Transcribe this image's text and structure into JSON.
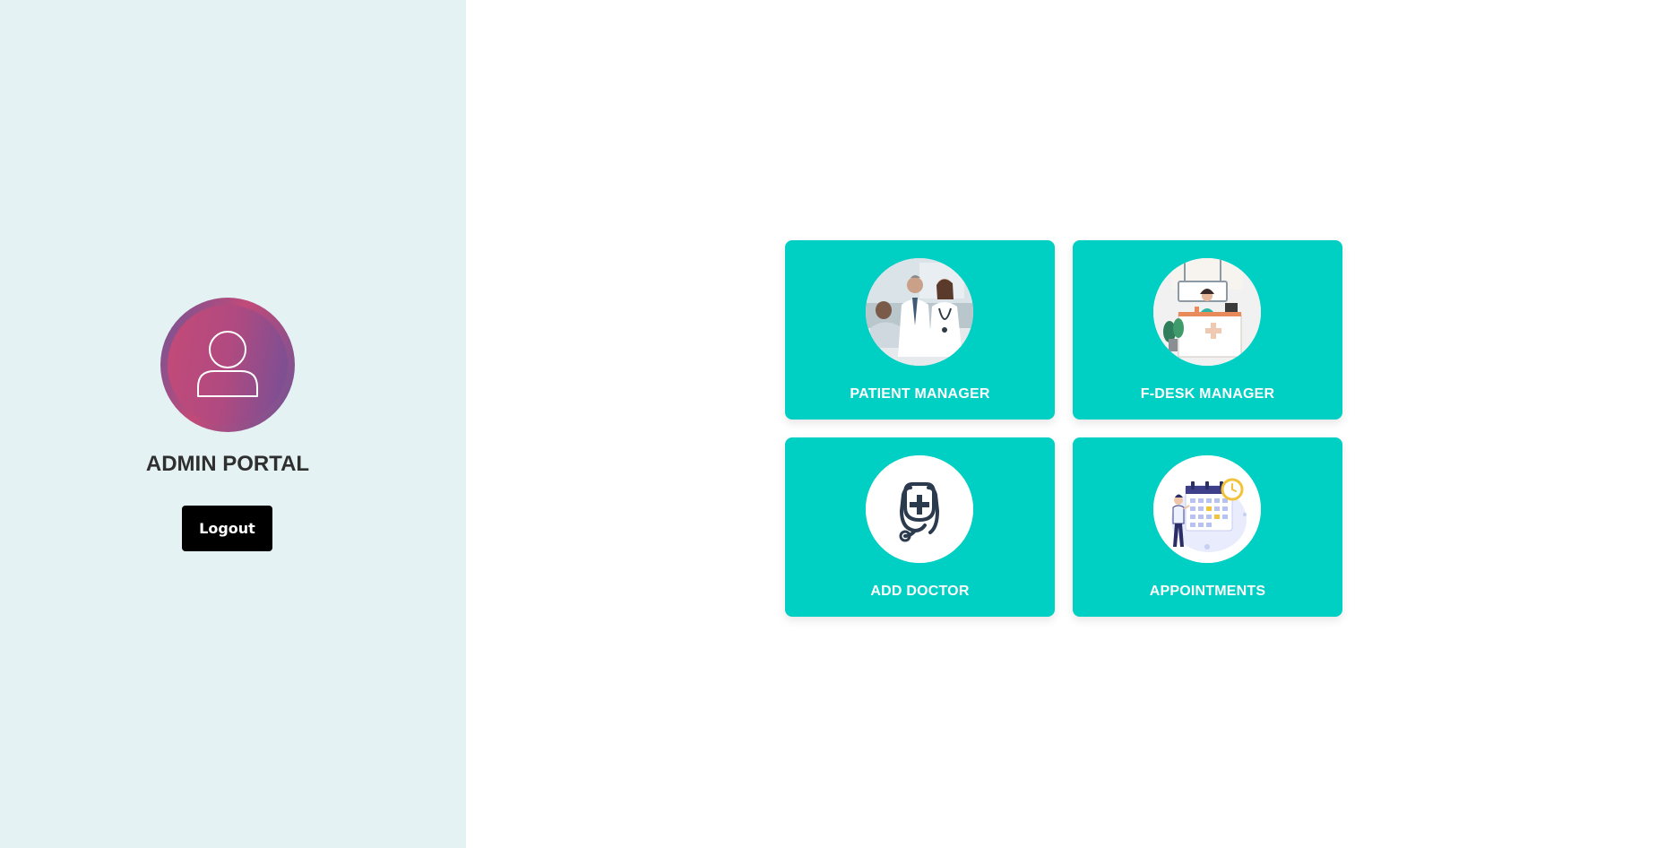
{
  "sidebar": {
    "avatar_icon": "user-profile-icon",
    "title": "ADMIN PORTAL",
    "logout_label": "Logout",
    "background_color": "#e4f2f3"
  },
  "dashboard": {
    "card_color": "#00cfc3",
    "cards": [
      {
        "label": "PATIENT MANAGER",
        "icon": "doctors-with-patient-image"
      },
      {
        "label": "F-DESK MANAGER",
        "icon": "front-desk-receptionist-image"
      },
      {
        "label": "ADD DOCTOR",
        "icon": "stethoscope-medical-icon"
      },
      {
        "label": "APPOINTMENTS",
        "icon": "calendar-schedule-image"
      }
    ]
  }
}
